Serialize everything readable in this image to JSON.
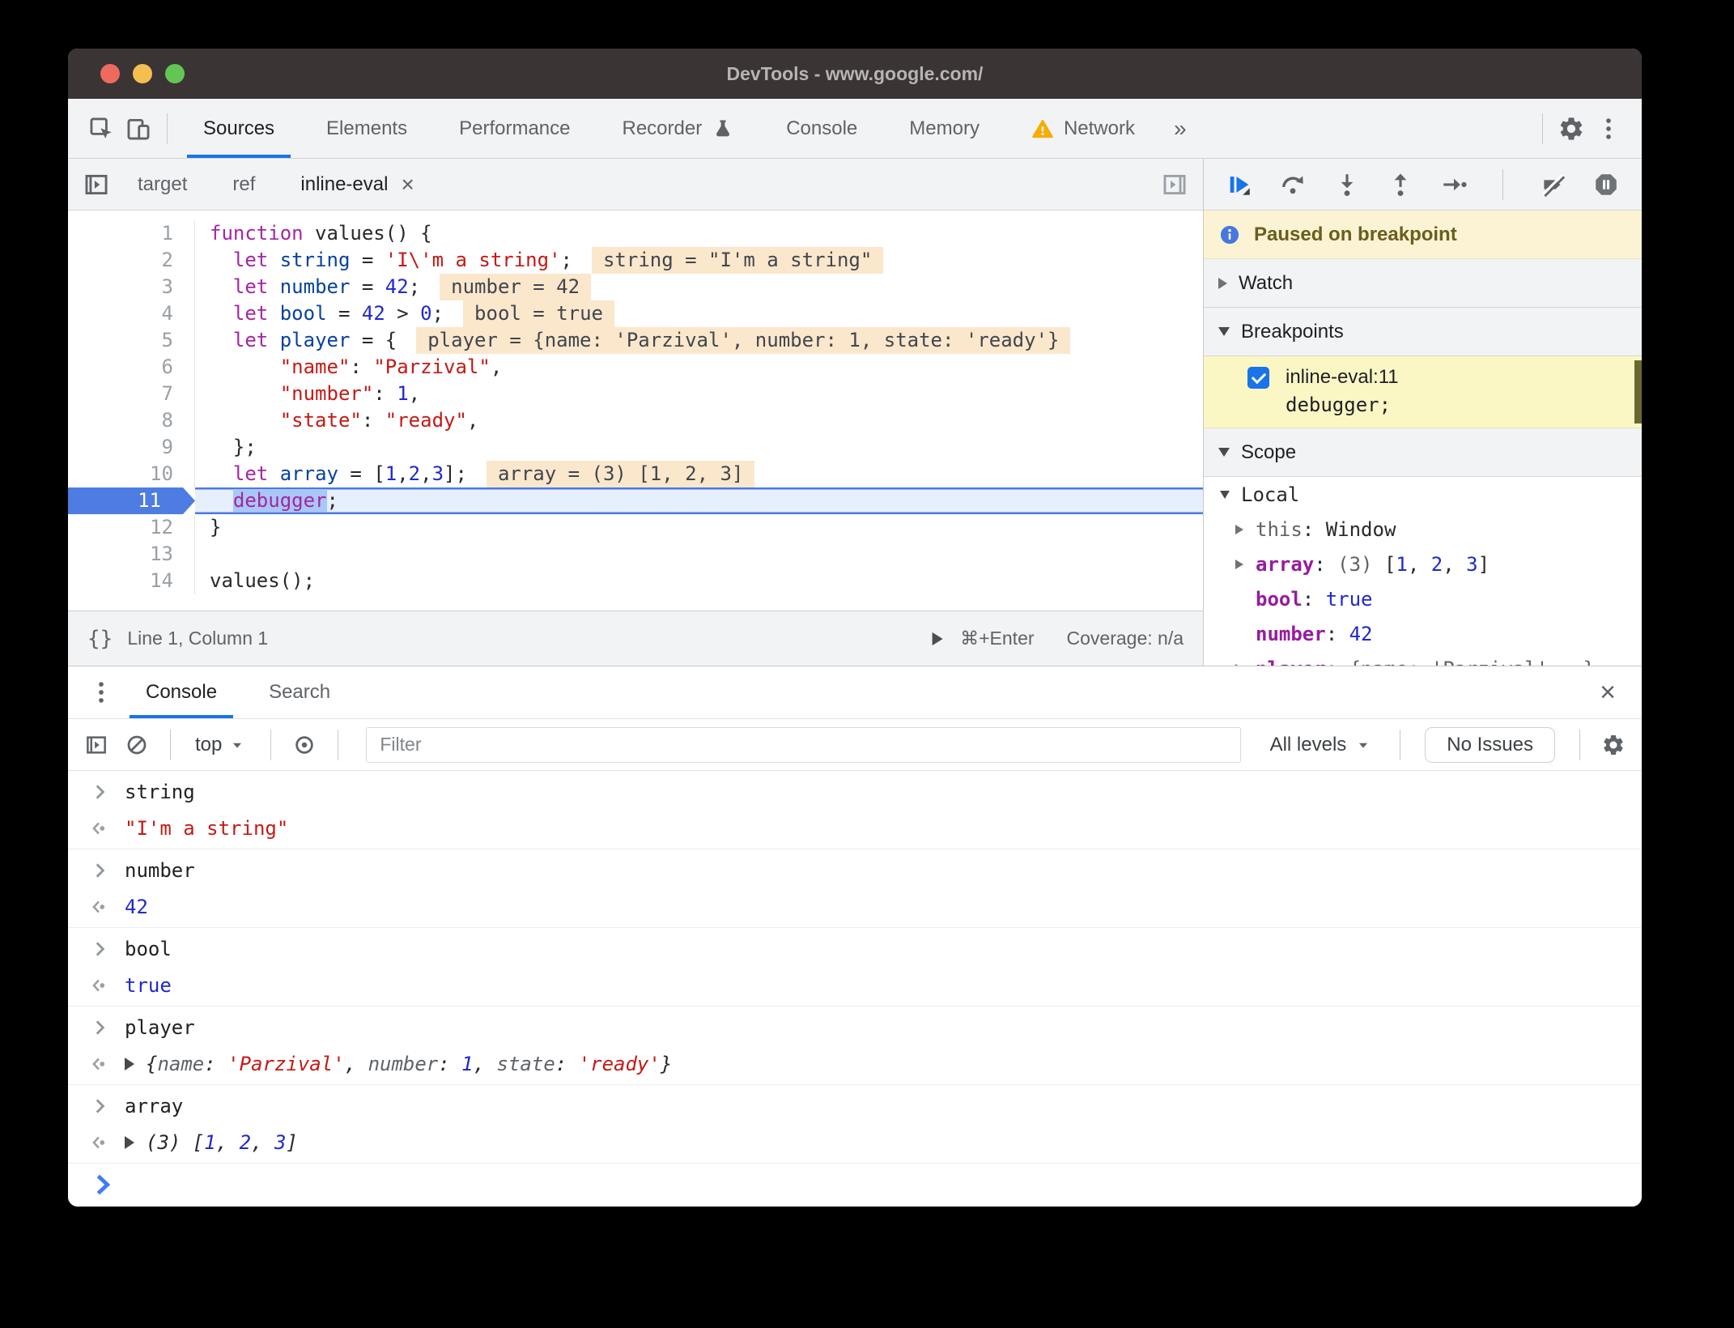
{
  "window": {
    "title": "DevTools - www.google.com/"
  },
  "glyphs": {
    "more_tabs": "»",
    "close": "×",
    "brackets": "{}"
  },
  "main_tabs": [
    {
      "label": "Sources",
      "active": true
    },
    {
      "label": "Elements"
    },
    {
      "label": "Performance"
    },
    {
      "label": "Recorder",
      "icon": "flask"
    },
    {
      "label": "Console"
    },
    {
      "label": "Memory"
    },
    {
      "label": "Network",
      "icon": "warn"
    }
  ],
  "file_tabs": [
    {
      "label": "target"
    },
    {
      "label": "ref"
    },
    {
      "label": "inline-eval",
      "active": true,
      "closable": true
    }
  ],
  "editor": {
    "lines": [
      {
        "n": 1,
        "t": [
          [
            "k",
            "function"
          ],
          [
            "p",
            " values() {"
          ]
        ]
      },
      {
        "n": 2,
        "t": [
          [
            "p",
            "  "
          ],
          [
            "k",
            "let"
          ],
          [
            "p",
            " "
          ],
          [
            "d",
            "string"
          ],
          [
            "p",
            " = "
          ],
          [
            "s",
            "'I\\'m a string'"
          ],
          [
            "p",
            ";"
          ]
        ],
        "w": "string = \"I'm a string\""
      },
      {
        "n": 3,
        "t": [
          [
            "p",
            "  "
          ],
          [
            "k",
            "let"
          ],
          [
            "p",
            " "
          ],
          [
            "d",
            "number"
          ],
          [
            "p",
            " = "
          ],
          [
            "n",
            "42"
          ],
          [
            "p",
            ";"
          ]
        ],
        "w": "number = 42"
      },
      {
        "n": 4,
        "t": [
          [
            "p",
            "  "
          ],
          [
            "k",
            "let"
          ],
          [
            "p",
            " "
          ],
          [
            "d",
            "bool"
          ],
          [
            "p",
            " = "
          ],
          [
            "n",
            "42"
          ],
          [
            "p",
            " > "
          ],
          [
            "n",
            "0"
          ],
          [
            "p",
            ";"
          ]
        ],
        "w": "bool = true"
      },
      {
        "n": 5,
        "t": [
          [
            "p",
            "  "
          ],
          [
            "k",
            "let"
          ],
          [
            "p",
            " "
          ],
          [
            "d",
            "player"
          ],
          [
            "p",
            " = {"
          ]
        ],
        "w": "player = {name: 'Parzival', number: 1, state: 'ready'}"
      },
      {
        "n": 6,
        "t": [
          [
            "p",
            "      "
          ],
          [
            "s",
            "\"name\""
          ],
          [
            "p",
            ": "
          ],
          [
            "s",
            "\"Parzival\""
          ],
          [
            "p",
            ","
          ]
        ]
      },
      {
        "n": 7,
        "t": [
          [
            "p",
            "      "
          ],
          [
            "s",
            "\"number\""
          ],
          [
            "p",
            ": "
          ],
          [
            "n",
            "1"
          ],
          [
            "p",
            ","
          ]
        ]
      },
      {
        "n": 8,
        "t": [
          [
            "p",
            "      "
          ],
          [
            "s",
            "\"state\""
          ],
          [
            "p",
            ": "
          ],
          [
            "s",
            "\"ready\""
          ],
          [
            "p",
            ","
          ]
        ]
      },
      {
        "n": 9,
        "t": [
          [
            "p",
            "  };"
          ]
        ]
      },
      {
        "n": 10,
        "t": [
          [
            "p",
            "  "
          ],
          [
            "k",
            "let"
          ],
          [
            "p",
            " "
          ],
          [
            "d",
            "array"
          ],
          [
            "p",
            " = ["
          ],
          [
            "n",
            "1"
          ],
          [
            "p",
            ","
          ],
          [
            "n",
            "2"
          ],
          [
            "p",
            ","
          ],
          [
            "n",
            "3"
          ],
          [
            "p",
            "];"
          ]
        ],
        "w": "array = (3) [1, 2, 3]"
      },
      {
        "n": 11,
        "current": true,
        "t": [
          [
            "p",
            "  "
          ],
          [
            "ks",
            "debugger"
          ],
          [
            "p",
            ";"
          ]
        ]
      },
      {
        "n": 12,
        "t": [
          [
            "p",
            "}"
          ]
        ]
      },
      {
        "n": 13,
        "t": []
      },
      {
        "n": 14,
        "t": [
          [
            "p",
            "values();"
          ]
        ]
      }
    ]
  },
  "status_bar": {
    "brackets": "{}",
    "position": "Line 1, Column 1",
    "shortcut": "⌘+Enter",
    "coverage": "Coverage: n/a"
  },
  "debugger": {
    "paused": "Paused on breakpoint",
    "watch_label": "Watch",
    "breakpoints_label": "Breakpoints",
    "breakpoint": {
      "label": "inline-eval:11",
      "code": "debugger;"
    },
    "scope_label": "Scope",
    "scope_rows": [
      {
        "ind": 0,
        "ar": "d",
        "t": [
          [
            "p",
            "Local"
          ]
        ]
      },
      {
        "ind": 1,
        "ar": "r",
        "t": [
          [
            "g",
            "this"
          ],
          [
            "p",
            ": "
          ],
          [
            "p",
            "Window"
          ]
        ]
      },
      {
        "ind": 1,
        "ar": "r",
        "t": [
          [
            "prop",
            "array"
          ],
          [
            "p",
            ": "
          ],
          [
            "g",
            "(3)"
          ],
          [
            "p",
            " ["
          ],
          [
            "n",
            "1"
          ],
          [
            "p",
            ", "
          ],
          [
            "n",
            "2"
          ],
          [
            "p",
            ", "
          ],
          [
            "n",
            "3"
          ],
          [
            "p",
            "]"
          ]
        ]
      },
      {
        "ind": 1,
        "t": [
          [
            "prop",
            "bool"
          ],
          [
            "p",
            ": "
          ],
          [
            "n",
            "true"
          ]
        ]
      },
      {
        "ind": 1,
        "t": [
          [
            "prop",
            "number"
          ],
          [
            "p",
            ": "
          ],
          [
            "n",
            "42"
          ]
        ]
      },
      {
        "ind": 1,
        "ar": "r",
        "t": [
          [
            "prop",
            "player"
          ],
          [
            "p",
            ": "
          ],
          [
            "g",
            "{name: 'Parzival', …}"
          ]
        ]
      }
    ]
  },
  "console": {
    "tabs": [
      {
        "label": "Console",
        "active": true
      },
      {
        "label": "Search"
      }
    ],
    "toolbar": {
      "context": "top",
      "filter_placeholder": "Filter",
      "levels": "All levels",
      "issues": "No Issues"
    },
    "groups": [
      {
        "input": "string",
        "result": {
          "t": [
            [
              "s",
              "\"I'm a string\""
            ]
          ]
        }
      },
      {
        "input": "number",
        "result": {
          "t": [
            [
              "n",
              "42"
            ]
          ]
        }
      },
      {
        "input": "bool",
        "result": {
          "t": [
            [
              "n",
              "true"
            ]
          ]
        }
      },
      {
        "input": "player",
        "result": {
          "it": true,
          "tri": true,
          "t": [
            [
              "p",
              "{"
            ],
            [
              "g",
              "name"
            ],
            [
              "p",
              ": "
            ],
            [
              "s",
              "'Parzival'"
            ],
            [
              "p",
              ", "
            ],
            [
              "g",
              "number"
            ],
            [
              "p",
              ": "
            ],
            [
              "n",
              "1"
            ],
            [
              "p",
              ", "
            ],
            [
              "g",
              "state"
            ],
            [
              "p",
              ": "
            ],
            [
              "s",
              "'ready'"
            ],
            [
              "p",
              "}"
            ]
          ]
        }
      },
      {
        "input": "array",
        "result": {
          "it": true,
          "tri": true,
          "t": [
            [
              "p",
              "(3) ["
            ],
            [
              "n",
              "1"
            ],
            [
              "p",
              ", "
            ],
            [
              "n",
              "2"
            ],
            [
              "p",
              ", "
            ],
            [
              "n",
              "3"
            ],
            [
              "p",
              "]"
            ]
          ]
        }
      }
    ]
  }
}
